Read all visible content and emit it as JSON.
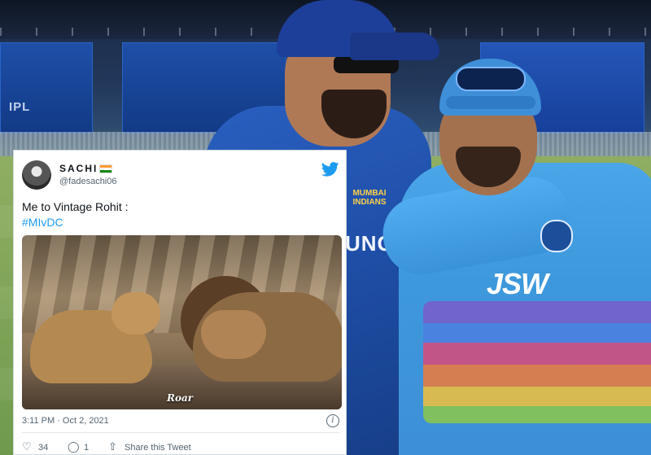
{
  "background": {
    "hoarding_text": "IPL",
    "player1_jersey_text": "UNG",
    "player1_badge_text": "MUMBAI INDIANS",
    "player2_jersey_text": "JSW"
  },
  "tweet": {
    "display_name": "SACHI",
    "handle": "@fadesachi06",
    "text_line1": "Me to Vintage Rohit :",
    "hashtag": "#MIvDC",
    "media_caption": "Roar",
    "timestamp": "3:11 PM · Oct 2, 2021",
    "info_glyph": "i",
    "bird_glyph": "🐦",
    "likes_count": "34",
    "replies_count": "1",
    "share_label": "Share this Tweet",
    "icons": {
      "like": "heart-icon",
      "reply": "reply-icon",
      "share": "share-icon"
    },
    "colors": {
      "link": "#1d9bf0",
      "text": "#0f1419",
      "muted": "#536471"
    }
  }
}
